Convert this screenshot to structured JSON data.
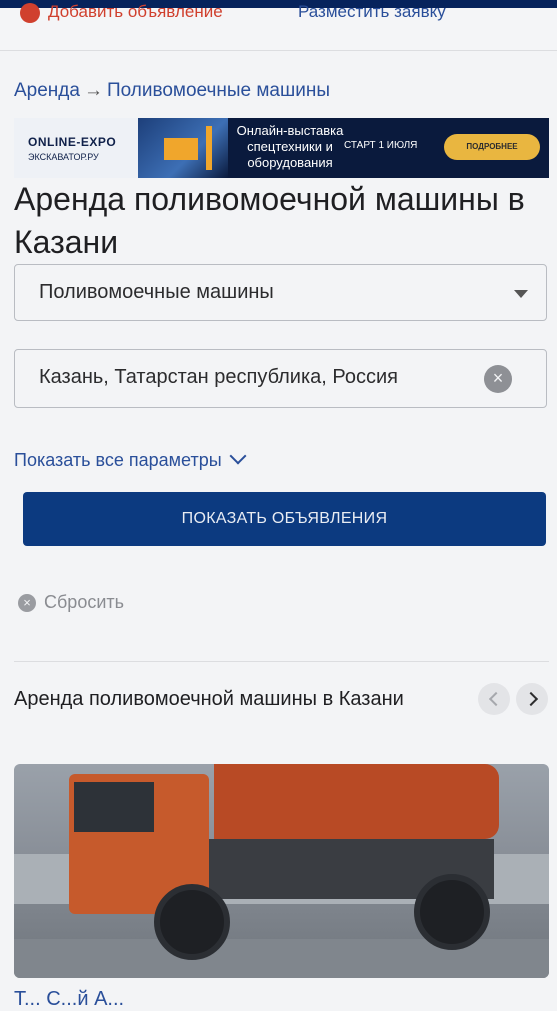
{
  "header": {
    "add_ad_label": "Добавить объявление",
    "place_request_label": "Разместить заявку"
  },
  "breadcrumb": {
    "root": "Аренда",
    "separator": "→",
    "current": "Поливомоечные машины"
  },
  "banner": {
    "logo_line1": "ONLINE-EXPO",
    "logo_line2": "ЭКСКАВАТОР.РУ",
    "headline": "Онлайн-выставка спецтехники и оборудования",
    "date": "СТАРТ 1 ИЮЛЯ",
    "button_label": "ПОДРОБНЕЕ"
  },
  "page_title": "Аренда поливомоечной машины в Казани",
  "filters": {
    "category_value": "Поливомоечные машины",
    "location_value": "Казань, Татарстан республика, Россия",
    "show_params_label": "Показать все параметры",
    "submit_label": "ПОКАЗАТЬ ОБЪЯВЛЕНИЯ",
    "reset_label": "Сбросить"
  },
  "section": {
    "title": "Аренда поливомоечной машины в Казани"
  },
  "listing": {
    "title_partial": "Т... С...й А..."
  },
  "colors": {
    "brand_navy": "#0c3a80",
    "link_blue": "#2a4f9a",
    "accent_red": "#d0402e",
    "banner_button": "#e9b640"
  }
}
